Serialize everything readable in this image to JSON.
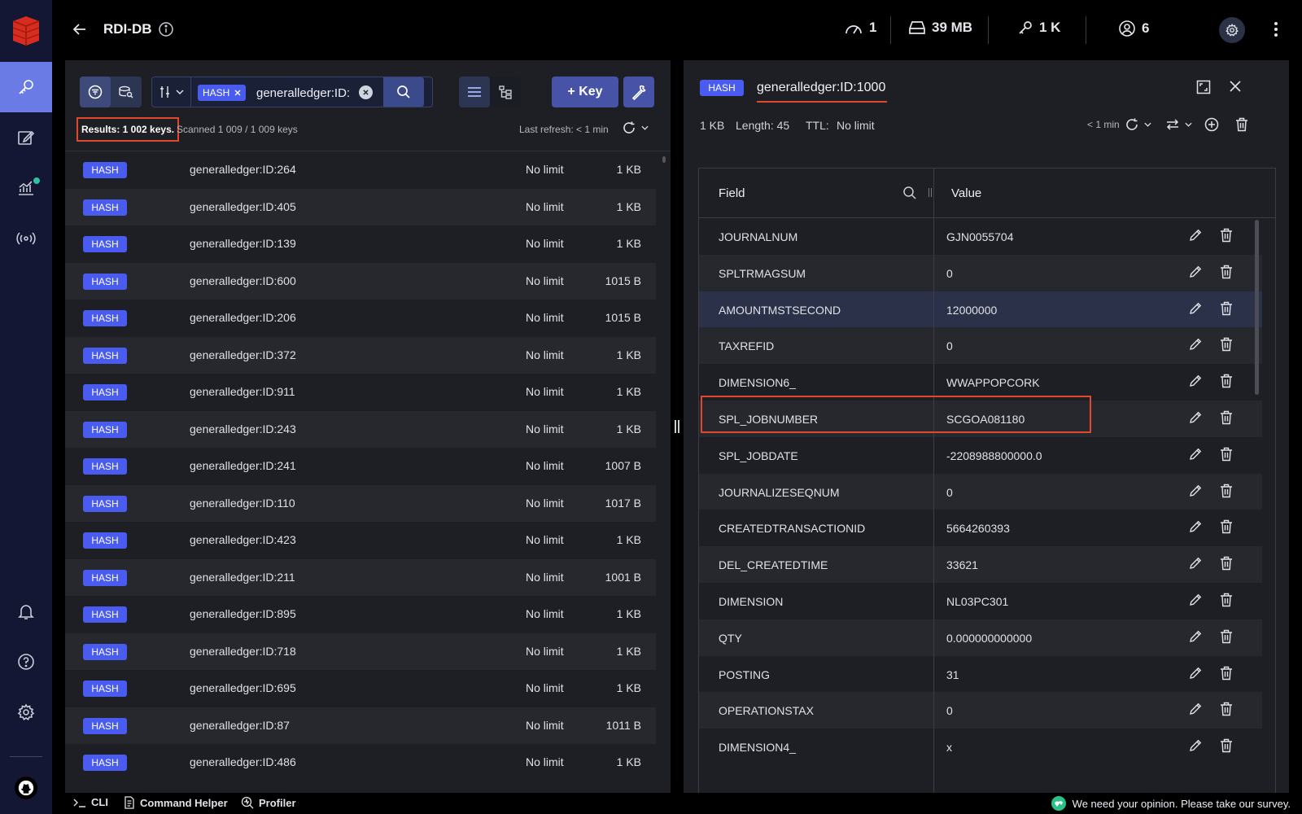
{
  "header": {
    "db_name": "RDI-DB",
    "stats": [
      {
        "name": "ops",
        "value": "1"
      },
      {
        "name": "memory",
        "value": "39 MB"
      },
      {
        "name": "keys",
        "value": "1 K"
      },
      {
        "name": "clients",
        "value": "6"
      }
    ]
  },
  "toolbar": {
    "type_filter": "HASH",
    "search_value": "generalledger:ID:",
    "add_key_label": "+ Key"
  },
  "results": {
    "summary": "Results: 1 002 keys.",
    "scanned": "Scanned 1 009 / 1 009 keys",
    "last_refresh": "Last refresh: < 1 min"
  },
  "keys": [
    {
      "type": "HASH",
      "name": "generalledger:ID:264",
      "ttl": "No limit",
      "size": "1 KB"
    },
    {
      "type": "HASH",
      "name": "generalledger:ID:405",
      "ttl": "No limit",
      "size": "1 KB"
    },
    {
      "type": "HASH",
      "name": "generalledger:ID:139",
      "ttl": "No limit",
      "size": "1 KB"
    },
    {
      "type": "HASH",
      "name": "generalledger:ID:600",
      "ttl": "No limit",
      "size": "1015 B"
    },
    {
      "type": "HASH",
      "name": "generalledger:ID:206",
      "ttl": "No limit",
      "size": "1015 B"
    },
    {
      "type": "HASH",
      "name": "generalledger:ID:372",
      "ttl": "No limit",
      "size": "1 KB"
    },
    {
      "type": "HASH",
      "name": "generalledger:ID:911",
      "ttl": "No limit",
      "size": "1 KB"
    },
    {
      "type": "HASH",
      "name": "generalledger:ID:243",
      "ttl": "No limit",
      "size": "1 KB"
    },
    {
      "type": "HASH",
      "name": "generalledger:ID:241",
      "ttl": "No limit",
      "size": "1007 B"
    },
    {
      "type": "HASH",
      "name": "generalledger:ID:110",
      "ttl": "No limit",
      "size": "1017 B"
    },
    {
      "type": "HASH",
      "name": "generalledger:ID:423",
      "ttl": "No limit",
      "size": "1 KB"
    },
    {
      "type": "HASH",
      "name": "generalledger:ID:211",
      "ttl": "No limit",
      "size": "1001 B"
    },
    {
      "type": "HASH",
      "name": "generalledger:ID:895",
      "ttl": "No limit",
      "size": "1 KB"
    },
    {
      "type": "HASH",
      "name": "generalledger:ID:718",
      "ttl": "No limit",
      "size": "1 KB"
    },
    {
      "type": "HASH",
      "name": "generalledger:ID:695",
      "ttl": "No limit",
      "size": "1 KB"
    },
    {
      "type": "HASH",
      "name": "generalledger:ID:87",
      "ttl": "No limit",
      "size": "1011 B"
    },
    {
      "type": "HASH",
      "name": "generalledger:ID:486",
      "ttl": "No limit",
      "size": "1 KB"
    }
  ],
  "details": {
    "type": "HASH",
    "key": "generalledger:ID:1000",
    "size": "1 KB",
    "length": "Length: 45",
    "ttl_label": "TTL:",
    "ttl_value": "No limit",
    "refresh": "< 1 min",
    "col_field": "Field",
    "col_value": "Value",
    "fields": [
      {
        "field": "JOURNALNUM",
        "value": "GJN0055704"
      },
      {
        "field": "SPLTRMAGSUM",
        "value": "0"
      },
      {
        "field": "AMOUNTMSTSECOND",
        "value": "12000000"
      },
      {
        "field": "TAXREFID",
        "value": "0"
      },
      {
        "field": "DIMENSION6_",
        "value": "WWAPPOPCORK"
      },
      {
        "field": "SPL_JOBNUMBER",
        "value": "SCGOA081180"
      },
      {
        "field": "SPL_JOBDATE",
        "value": "-2208988800000.0"
      },
      {
        "field": "JOURNALIZESEQNUM",
        "value": "0"
      },
      {
        "field": "CREATEDTRANSACTIONID",
        "value": "5664260393"
      },
      {
        "field": "DEL_CREATEDTIME",
        "value": "33621"
      },
      {
        "field": "DIMENSION",
        "value": "NL03PC301"
      },
      {
        "field": "QTY",
        "value": "0.000000000000"
      },
      {
        "field": "POSTING",
        "value": "31"
      },
      {
        "field": "OPERATIONSTAX",
        "value": "0"
      },
      {
        "field": "DIMENSION4_",
        "value": "x"
      }
    ],
    "selected_index": 2
  },
  "bottom_bar": {
    "cli": "CLI",
    "command_helper": "Command Helper",
    "profiler": "Profiler",
    "survey": "We need your opinion. Please take our survey."
  },
  "colors": {
    "accent": "#4a5cf0",
    "highlight": "#e0492e",
    "sidebar": "#131733",
    "panel": "#1e1f24"
  }
}
